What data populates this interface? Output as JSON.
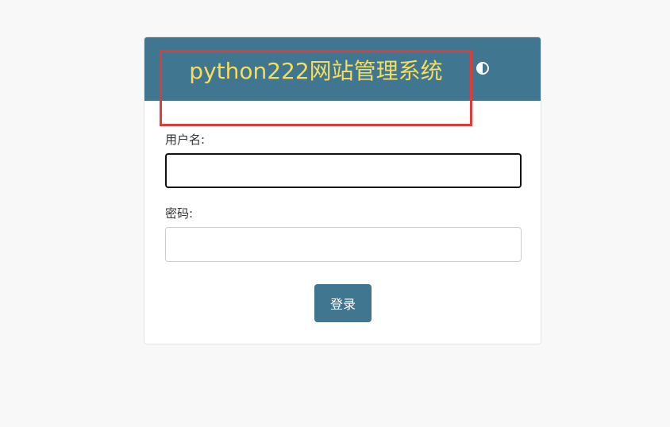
{
  "header": {
    "title": "python222网站管理系统",
    "theme_toggle_icon": "half-circle-contrast-icon"
  },
  "form": {
    "username_label": "用户名:",
    "username_value": "",
    "password_label": "密码:",
    "password_value": "",
    "login_button_label": "登录"
  },
  "colors": {
    "header_background": "#417690",
    "title_color": "#f5dd5d",
    "button_background": "#417690",
    "highlight_border": "#e53935",
    "page_background": "#f8f8f8"
  }
}
